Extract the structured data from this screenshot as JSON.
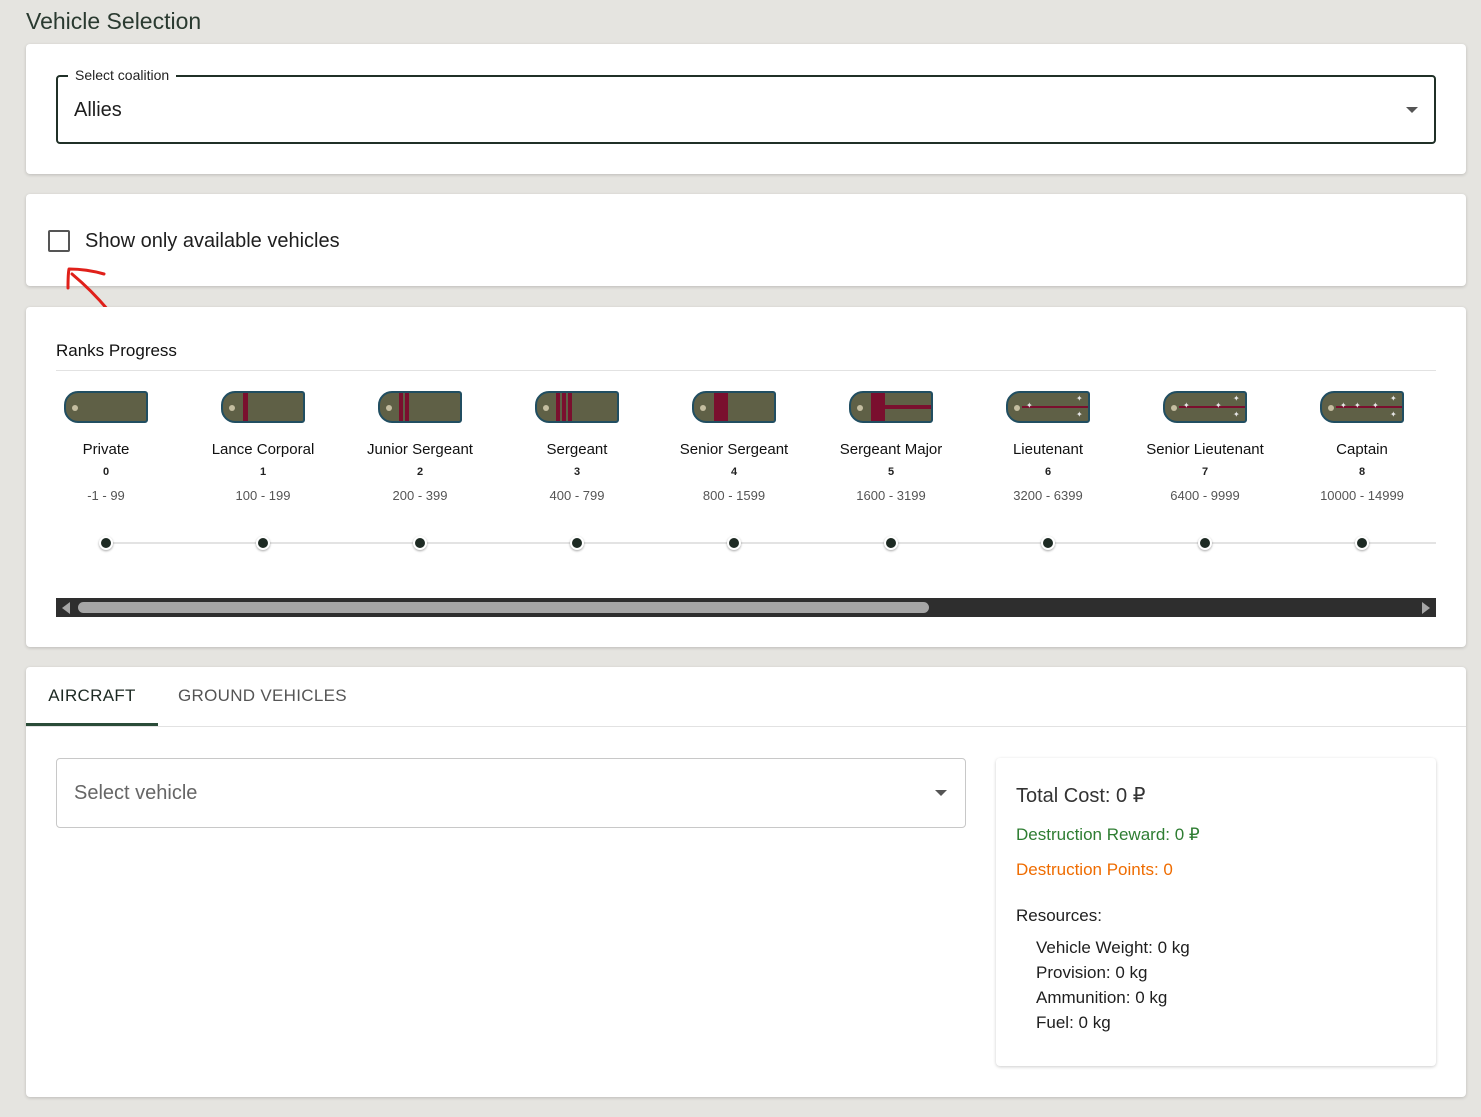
{
  "page": {
    "title": "Vehicle Selection"
  },
  "coalition": {
    "label": "Select coalition",
    "value": "Allies"
  },
  "filter": {
    "label": "Show only available vehicles",
    "checked": false
  },
  "ranks": {
    "title": "Ranks Progress",
    "items": [
      {
        "name": "Private",
        "level": "0",
        "range": "-1 - 99"
      },
      {
        "name": "Lance Corporal",
        "level": "1",
        "range": "100 - 199"
      },
      {
        "name": "Junior Sergeant",
        "level": "2",
        "range": "200 - 399"
      },
      {
        "name": "Sergeant",
        "level": "3",
        "range": "400 - 799"
      },
      {
        "name": "Senior Sergeant",
        "level": "4",
        "range": "800 - 1599"
      },
      {
        "name": "Sergeant Major",
        "level": "5",
        "range": "1600 - 3199"
      },
      {
        "name": "Lieutenant",
        "level": "6",
        "range": "3200 - 6399"
      },
      {
        "name": "Senior Lieutenant",
        "level": "7",
        "range": "6400 - 9999"
      },
      {
        "name": "Captain",
        "level": "8",
        "range": "10000 - 14999"
      }
    ]
  },
  "tabs": {
    "aircraft": "AIRCRAFT",
    "ground": "GROUND VEHICLES",
    "active": "AIRCRAFT"
  },
  "vehicle_select": {
    "placeholder": "Select vehicle"
  },
  "summary": {
    "total_cost": "Total Cost: 0 ₽",
    "destruction_reward": "Destruction Reward: 0 ₽",
    "destruction_points": "Destruction Points: 0",
    "resources_label": "Resources:",
    "vehicle_weight": "Vehicle Weight: 0 kg",
    "provision": "Provision: 0 kg",
    "ammunition": "Ammunition: 0 kg",
    "fuel": "Fuel: 0 kg"
  },
  "colors": {
    "accent": "#2a4c38",
    "reward": "#2e7d32",
    "points": "#ef6c00",
    "strap": "#5f6046",
    "stripe": "#7a0f2e"
  },
  "icons": {
    "coalition_caret": "chevron-down-icon",
    "vehicle_caret": "chevron-down-icon",
    "annotation": "red-arrow-annotation"
  }
}
